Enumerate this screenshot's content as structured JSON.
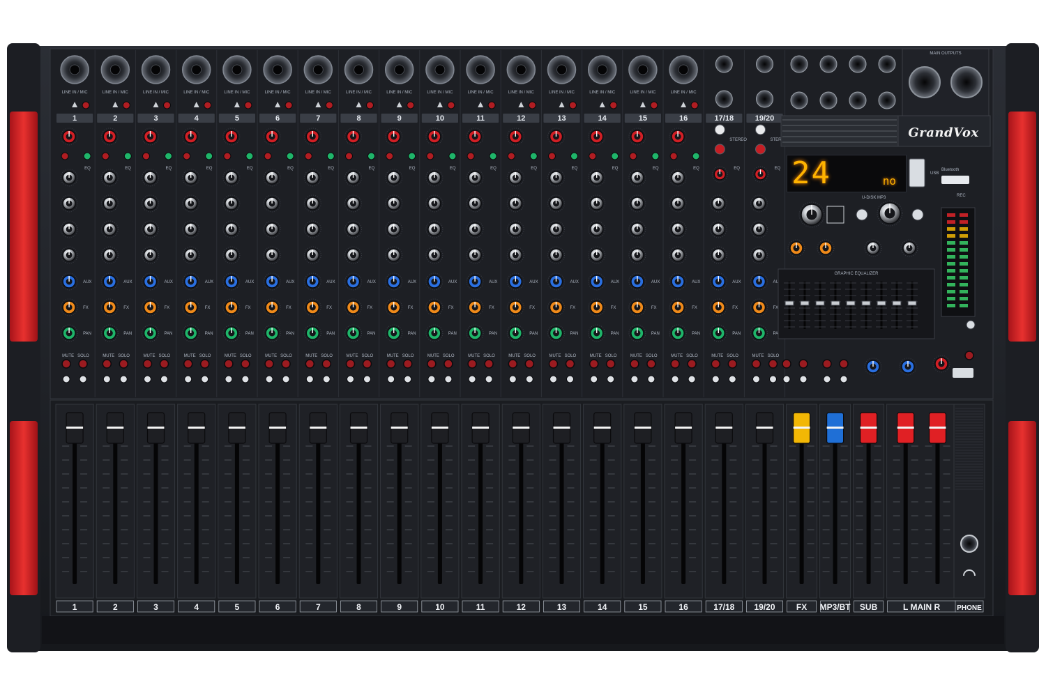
{
  "brand": "GrandVox",
  "display": {
    "main": "24",
    "sub": "no"
  },
  "channels": {
    "mono_count": 16,
    "stereo_labels": [
      "17/18",
      "19/20"
    ],
    "input_label": "LINE IN / MIC",
    "stereo_text": "STEREO"
  },
  "faders": {
    "labels": [
      "1",
      "2",
      "3",
      "4",
      "5",
      "6",
      "7",
      "8",
      "9",
      "10",
      "11",
      "12",
      "13",
      "14",
      "15",
      "16",
      "17/18",
      "19/20",
      "FX",
      "MP3/BT",
      "SUB",
      "L   MAIN   R"
    ],
    "phone_label": "PHONE"
  },
  "buttons": {
    "mute": "MUTE",
    "solo": "SOLO"
  },
  "knob_labels": {
    "eq": "EQ",
    "aux": "AUX",
    "fx": "FX",
    "pan": "PAN"
  },
  "panels": {
    "main_outputs": "MAIN OUTPUTS",
    "graphic_eq": "GRAPHIC EQUALIZER",
    "usb_mp3": "U-DISK MP3",
    "bluetooth": "Bluetooth",
    "usb": "USB",
    "rec": "REC"
  },
  "colors": {
    "body": "#24272d",
    "panel": "#1b1d22",
    "side_red": "#d8262a",
    "fader_yellow": "#f2b705",
    "fader_blue": "#1f6fd6",
    "fader_red": "#e02024",
    "knob_red": "#d11f25",
    "knob_blue": "#2a6fe0",
    "knob_orange": "#ef8a1a",
    "knob_green": "#1fb56a",
    "led_amber": "#ffb300"
  }
}
